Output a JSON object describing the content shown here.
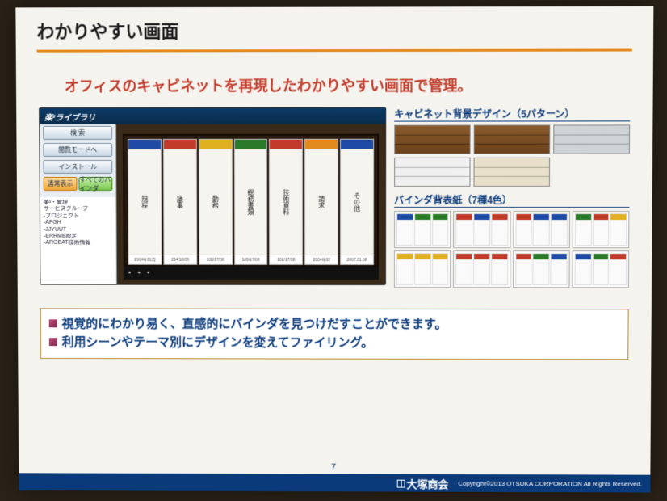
{
  "title": "わかりやすい画面",
  "subhead": "オフィスのキャビネットを再現したわかりやすい画面で管理。",
  "app": {
    "logo": "楽²ライブラリ",
    "side_buttons": [
      "検 索",
      "閲覧モードへ",
      "インストール"
    ],
    "toggles": [
      "通常表示",
      "すべてのバインダ"
    ],
    "tree": [
      "楽²・管理",
      "サービスグループ",
      "-プロジェクト",
      "-AFGH",
      "-JJYUUT",
      "-ERRMB設定",
      "-ARGBAT技術情報"
    ],
    "binders": [
      {
        "color": "#1f4aa6",
        "label": "規程"
      },
      {
        "color": "#c23a2a",
        "label": "議事"
      },
      {
        "color": "#e0b020",
        "label": "勤務"
      },
      {
        "color": "#2a7a2a",
        "label": "総務書類"
      },
      {
        "color": "#c23a2a",
        "label": "技術資料"
      },
      {
        "color": "#e38a1f",
        "label": "請求"
      },
      {
        "color": "#1f4aa6",
        "label": "その他"
      }
    ],
    "foot_dates": [
      "2004年01月",
      "234/18/08",
      "108/17/08",
      "109/17/08",
      "108/17/08",
      "2004年02",
      "2007.01.08"
    ]
  },
  "right": {
    "cab_head": "キャビネット背景デザイン（5パターン）",
    "bind_head": "バインダ背表紙（7種4色）",
    "binder_colors": [
      [
        "#1f4aa6",
        "#2a7a2a",
        "#2a7a2a"
      ],
      [
        "#c23a2a",
        "#1f4aa6",
        "#c23a2a"
      ],
      [
        "#c23a2a",
        "#1f4aa6",
        "#1f4aa6"
      ],
      [
        "#2a7a2a",
        "#c23a2a",
        "#e0b020"
      ],
      [
        "#e0b020",
        "#e0b020",
        "#e0b020"
      ],
      [
        "#c23a2a",
        "#c23a2a",
        "#c23a2a"
      ],
      [
        "#c23a2a",
        "#2a7a2a",
        "#1f4aa6"
      ],
      [
        "#1f4aa6",
        "#2a7a2a",
        "#c23a2a"
      ]
    ]
  },
  "bullets": [
    "視覚的にわかり易く、直感的にバインダを見つけだすことができます。",
    "利用シーンやテーマ別にデザインを変えてファイリング。"
  ],
  "page_number": "7",
  "footer": {
    "brand": "大塚商会",
    "copyright": "Copyright©2013 OTSUKA CORPORATION All Rights Reserved."
  }
}
